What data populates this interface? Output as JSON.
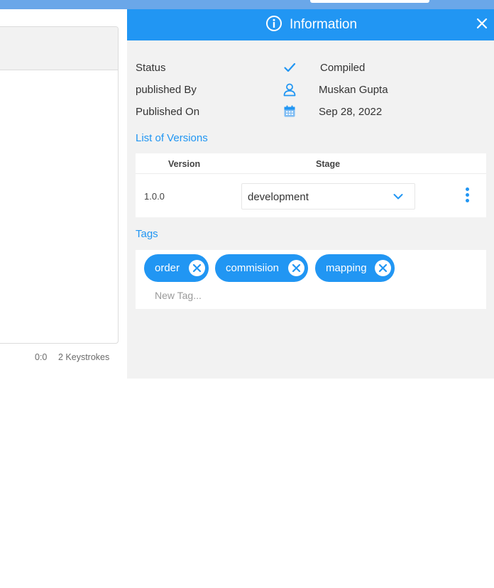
{
  "editor": {
    "cursor_position": "0:0",
    "keystrokes": "2 Keystrokes"
  },
  "info_panel": {
    "title": "Information",
    "close_icon": "close-icon",
    "status": {
      "label": "Status",
      "icon": "check-icon",
      "value": "Compiled"
    },
    "published_by": {
      "label": "published By",
      "icon": "user-icon",
      "value": "Muskan Gupta"
    },
    "published_on": {
      "label": "Published On",
      "icon": "calendar-icon",
      "value": "Sep 28, 2022"
    },
    "versions": {
      "title": "List of Versions",
      "columns": [
        "Version",
        "Stage"
      ],
      "rows": [
        {
          "version": "1.0.0",
          "stage": "development"
        }
      ]
    },
    "tags": {
      "title": "Tags",
      "items": [
        "order",
        "commisiion",
        "mapping"
      ],
      "new_tag_placeholder": "New Tag..."
    }
  },
  "colors": {
    "accent": "#2196f3",
    "topbar": "#6aa7e9",
    "panel_bg": "#f2f2f2"
  }
}
